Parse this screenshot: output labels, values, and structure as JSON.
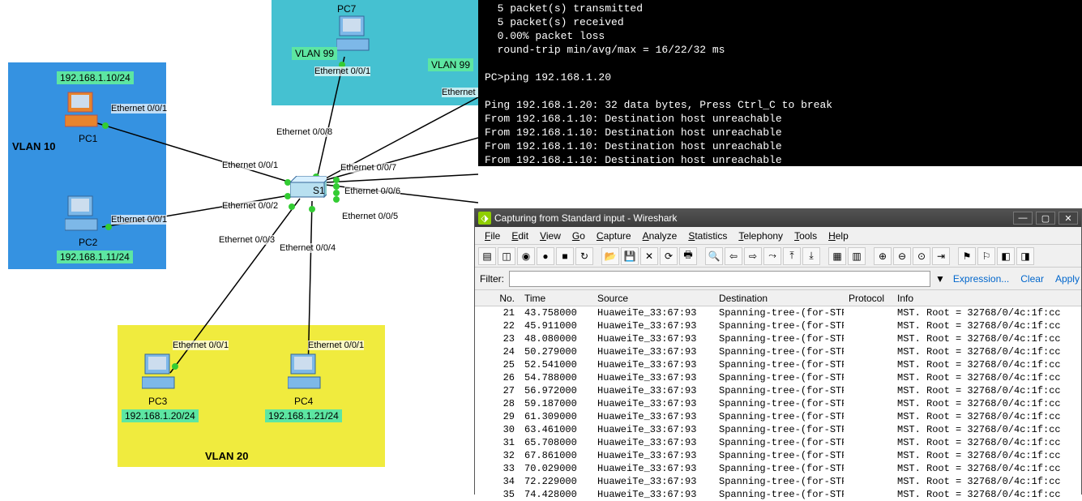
{
  "topology": {
    "vlan10_label": "VLAN 10",
    "vlan20_label": "VLAN 20",
    "vlan99_label": "VLAN 99",
    "vlan99_label2": "VLAN 99",
    "pc1": {
      "name": "PC1",
      "ip": "192.168.1.10/24",
      "port": "Ethernet 0/0/1"
    },
    "pc2": {
      "name": "PC2",
      "ip": "192.168.1.11/24",
      "port": "Ethernet 0/0/1"
    },
    "pc3": {
      "name": "PC3",
      "ip": "192.168.1.20/24",
      "port": "Ethernet 0/0/1"
    },
    "pc4": {
      "name": "PC4",
      "ip": "192.168.1.21/24",
      "port": "Ethernet 0/0/1"
    },
    "pc7": {
      "name": "PC7",
      "port": "Ethernet 0/0/1"
    },
    "switch": {
      "name": "S1"
    },
    "ports": {
      "e001": "Ethernet 0/0/1",
      "e002": "Ethernet 0/0/2",
      "e003": "Ethernet 0/0/3",
      "e004": "Ethernet 0/0/4",
      "e005": "Ethernet 0/0/5",
      "e006": "Ethernet 0/0/6",
      "e007": "Ethernet 0/0/7",
      "e008": "Ethernet 0/0/8",
      "ethernet_r": "Ethernet ("
    }
  },
  "terminal": {
    "lines": [
      "  5 packet(s) transmitted",
      "  5 packet(s) received",
      "  0.00% packet loss",
      "  round-trip min/avg/max = 16/22/32 ms",
      "",
      "PC>ping 192.168.1.20",
      "",
      "Ping 192.168.1.20: 32 data bytes, Press Ctrl_C to break",
      "From 192.168.1.10: Destination host unreachable",
      "From 192.168.1.10: Destination host unreachable",
      "From 192.168.1.10: Destination host unreachable",
      "From 192.168.1.10: Destination host unreachable",
      "From 192.168.1.10: Destination host unreachable"
    ]
  },
  "wireshark": {
    "title": "Capturing from Standard input - Wireshark",
    "menu": [
      "File",
      "Edit",
      "View",
      "Go",
      "Capture",
      "Analyze",
      "Statistics",
      "Telephony",
      "Tools",
      "Help"
    ],
    "filter_label": "Filter:",
    "filter_value": "",
    "dropdown": "▼",
    "expression": "Expression...",
    "clear": "Clear",
    "apply": "Apply",
    "headers": {
      "no": "No.",
      "time": "Time",
      "src": "Source",
      "dst": "Destination",
      "proto": "Protocol",
      "info": "Info"
    },
    "packets": [
      {
        "no": "21",
        "time": "43.758000",
        "src": "HuaweiTe_33:67:93",
        "dst": "Spanning-tree-(for-STP",
        "proto": "",
        "info": "MST. Root = 32768/0/4c:1f:cc"
      },
      {
        "no": "22",
        "time": "45.911000",
        "src": "HuaweiTe_33:67:93",
        "dst": "Spanning-tree-(for-STP",
        "proto": "",
        "info": "MST. Root = 32768/0/4c:1f:cc"
      },
      {
        "no": "23",
        "time": "48.080000",
        "src": "HuaweiTe_33:67:93",
        "dst": "Spanning-tree-(for-STP",
        "proto": "",
        "info": "MST. Root = 32768/0/4c:1f:cc"
      },
      {
        "no": "24",
        "time": "50.279000",
        "src": "HuaweiTe_33:67:93",
        "dst": "Spanning-tree-(for-STP",
        "proto": "",
        "info": "MST. Root = 32768/0/4c:1f:cc"
      },
      {
        "no": "25",
        "time": "52.541000",
        "src": "HuaweiTe_33:67:93",
        "dst": "Spanning-tree-(for-STP",
        "proto": "",
        "info": "MST. Root = 32768/0/4c:1f:cc"
      },
      {
        "no": "26",
        "time": "54.788000",
        "src": "HuaweiTe_33:67:93",
        "dst": "Spanning-tree-(for-STP",
        "proto": "",
        "info": "MST. Root = 32768/0/4c:1f:cc"
      },
      {
        "no": "27",
        "time": "56.972000",
        "src": "HuaweiTe_33:67:93",
        "dst": "Spanning-tree-(for-STP",
        "proto": "",
        "info": "MST. Root = 32768/0/4c:1f:cc"
      },
      {
        "no": "28",
        "time": "59.187000",
        "src": "HuaweiTe_33:67:93",
        "dst": "Spanning-tree-(for-STP",
        "proto": "",
        "info": "MST. Root = 32768/0/4c:1f:cc"
      },
      {
        "no": "29",
        "time": "61.309000",
        "src": "HuaweiTe_33:67:93",
        "dst": "Spanning-tree-(for-STP",
        "proto": "",
        "info": "MST. Root = 32768/0/4c:1f:cc"
      },
      {
        "no": "30",
        "time": "63.461000",
        "src": "HuaweiTe_33:67:93",
        "dst": "Spanning-tree-(for-STP",
        "proto": "",
        "info": "MST. Root = 32768/0/4c:1f:cc"
      },
      {
        "no": "31",
        "time": "65.708000",
        "src": "HuaweiTe_33:67:93",
        "dst": "Spanning-tree-(for-STP",
        "proto": "",
        "info": "MST. Root = 32768/0/4c:1f:cc"
      },
      {
        "no": "32",
        "time": "67.861000",
        "src": "HuaweiTe_33:67:93",
        "dst": "Spanning-tree-(for-STP",
        "proto": "",
        "info": "MST. Root = 32768/0/4c:1f:cc"
      },
      {
        "no": "33",
        "time": "70.029000",
        "src": "HuaweiTe_33:67:93",
        "dst": "Spanning-tree-(for-STP",
        "proto": "",
        "info": "MST. Root = 32768/0/4c:1f:cc"
      },
      {
        "no": "34",
        "time": "72.229000",
        "src": "HuaweiTe_33:67:93",
        "dst": "Spanning-tree-(for-STP",
        "proto": "",
        "info": "MST. Root = 32768/0/4c:1f:cc"
      },
      {
        "no": "35",
        "time": "74.428000",
        "src": "HuaweiTe_33:67:93",
        "dst": "Spanning-tree-(for-STP",
        "proto": "",
        "info": "MST. Root = 32768/0/4c:1f:cc"
      }
    ]
  }
}
